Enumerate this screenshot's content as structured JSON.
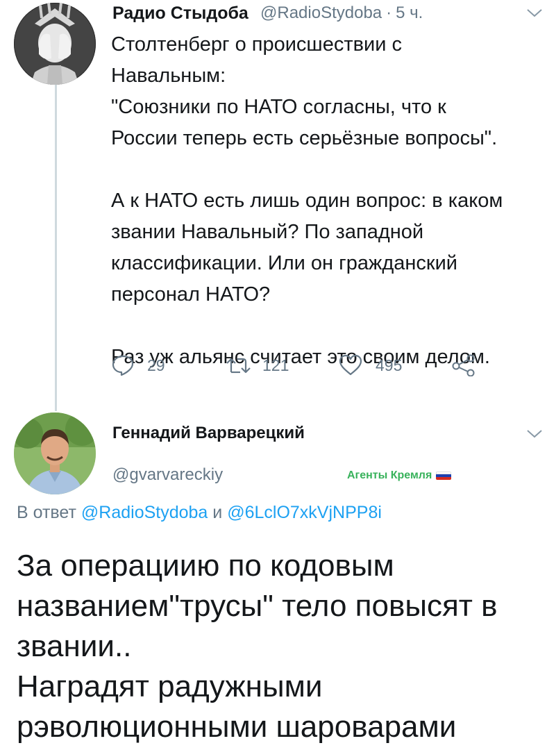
{
  "tweet1": {
    "display_name": "Радио Стыдоба",
    "handle": "@RadioStydoba",
    "separator": "·",
    "time": "5 ч.",
    "lines": [
      "Столтенберг о происшествии с",
      "Навальным:",
      "\"Союзники по НАТО согласны, что к",
      "России теперь есть серьёзные вопросы\".",
      "",
      "А к НАТО есть лишь один вопрос: в каком",
      "звании Навальный? По западной",
      "классификации. Или он гражданский",
      "персонал НАТО?",
      "",
      "Раз уж альянс считает это своим делом."
    ],
    "replies": "29",
    "retweets": "121",
    "likes": "495",
    "icons": [
      "reply-icon",
      "retweet-icon",
      "like-icon",
      "share-icon",
      "chevron-down-icon"
    ]
  },
  "tweet2": {
    "display_name": "Геннадий Варварецкий",
    "handle": "@gvarvareckiy",
    "badge": "Агенты Кремля",
    "reply_prefix": "В ответ",
    "reply_to_1": "@RadioStydoba",
    "reply_and": "и",
    "reply_to_2": "@6LclO7xkVjNPP8i",
    "lines": [
      "За операциию по кодовым",
      "названием\"трусы\" тело повысят в",
      "звании..",
      "Наградят радужными",
      "рэволюционными шароварами"
    ]
  },
  "colors": {
    "text": "#14171a",
    "secondary": "#657786",
    "link": "#1da1f2",
    "badge": "#38b25b",
    "thread_line": "#cfd9de"
  }
}
